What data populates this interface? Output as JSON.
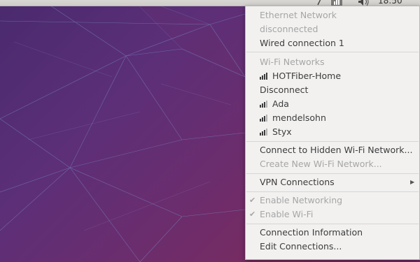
{
  "topbar": {
    "clock": "18:50",
    "icons": [
      "keyboard-icon",
      "network-icon",
      "volume-icon"
    ]
  },
  "menu": {
    "ethernet_header": "Ethernet Network",
    "ethernet_status": "disconnected",
    "wired_connection": "Wired connection 1",
    "wifi_header": "Wi-Fi Networks",
    "connected_network": "HOTFiber-Home",
    "disconnect": "Disconnect",
    "networks": [
      "Ada",
      "mendelsohn",
      "Styx"
    ],
    "connect_hidden": "Connect to Hidden Wi-Fi Network...",
    "create_new": "Create New Wi-Fi Network...",
    "vpn": "VPN Connections",
    "enable_networking": "Enable Networking",
    "enable_wifi": "Enable Wi-Fi",
    "connection_info": "Connection Information",
    "edit_connections": "Edit Connections..."
  },
  "colors": {
    "menu_bg": "#f2f1f0",
    "text": "#3c3c3c",
    "disabled_text": "#a6a6a6",
    "wallpaper_purple": "#5b2f78"
  }
}
